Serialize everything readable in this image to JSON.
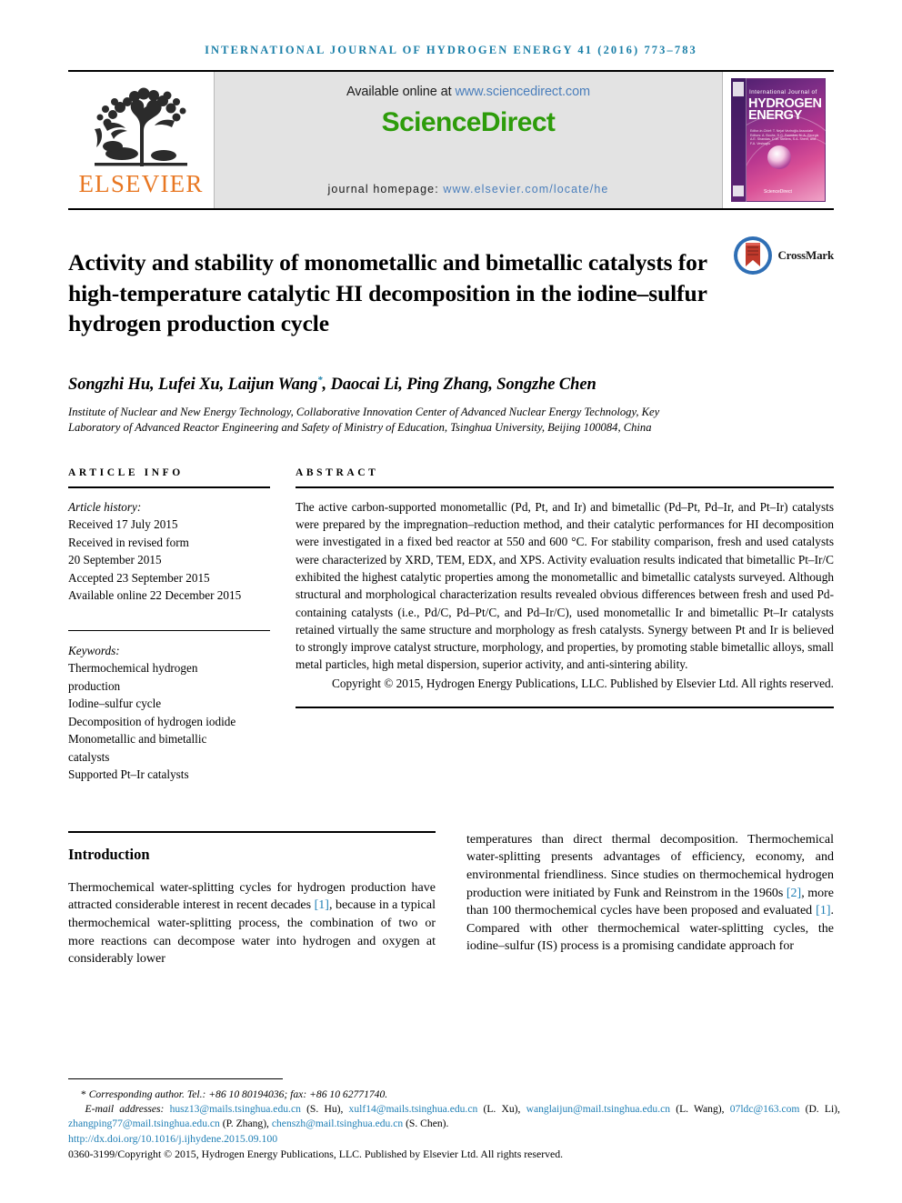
{
  "running_head": "International Journal of Hydrogen Energy 41 (2016) 773–783",
  "masthead": {
    "publisher_name": "ELSEVIER",
    "available_prefix": "Available online at ",
    "available_url": "www.sciencedirect.com",
    "sciencedirect_logo": "ScienceDirect",
    "homepage_prefix": "journal homepage: ",
    "homepage_url": "www.elsevier.com/locate/he",
    "cover": {
      "line_small": "International Journal of",
      "line_big_1": "HYDROGEN",
      "line_big_2": "ENERGY",
      "editors": "Editor-in-Chief:  T. Nejat Veziroğlu\nAssociate Editors:  A. Bouhs, D.G. Foundos, N. A. Georgis\nA.E. Shandas, D.W. Stellers,\nS.A. Sherif, and F.A. Vesiroglu",
      "sd_mark": "ScienceDirect"
    }
  },
  "article": {
    "title": "Activity and stability of monometallic and bimetallic catalysts for high-temperature catalytic HI decomposition in the iodine–sulfur hydrogen production cycle",
    "crossmark_label": "CrossMark",
    "authors": "Songzhi Hu, Lufei Xu, Laijun Wang",
    "authors_corr_marker": "*",
    "authors_rest": ", Daocai Li, Ping Zhang, Songzhe Chen",
    "affiliation": "Institute of Nuclear and New Energy Technology, Collaborative Innovation Center of Advanced Nuclear Energy Technology, Key Laboratory of Advanced Reactor Engineering and Safety of Ministry of Education, Tsinghua University, Beijing 100084, China"
  },
  "article_info": {
    "heading": "ARTICLE INFO",
    "history_label": "Article history:",
    "history": [
      "Received 17 July 2015",
      "Received in revised form",
      "20 September 2015",
      "Accepted 23 September 2015",
      "Available online 22 December 2015"
    ],
    "keywords_label": "Keywords:",
    "keywords": [
      "Thermochemical hydrogen",
      "production",
      "Iodine–sulfur cycle",
      "Decomposition of hydrogen iodide",
      "Monometallic and bimetallic",
      "catalysts",
      "Supported Pt–Ir catalysts"
    ]
  },
  "abstract": {
    "heading": "ABSTRACT",
    "body": "The active carbon-supported monometallic (Pd, Pt, and Ir) and bimetallic (Pd–Pt, Pd–Ir, and Pt–Ir) catalysts were prepared by the impregnation–reduction method, and their catalytic performances for HI decomposition were investigated in a fixed bed reactor at 550 and 600 °C. For stability comparison, fresh and used catalysts were characterized by XRD, TEM, EDX, and XPS. Activity evaluation results indicated that bimetallic Pt–Ir/C exhibited the highest catalytic properties among the monometallic and bimetallic catalysts surveyed. Although structural and morphological characterization results revealed obvious differences between fresh and used Pd-containing catalysts (i.e., Pd/C, Pd–Pt/C, and Pd–Ir/C), used monometallic Ir and bimetallic Pt–Ir catalysts retained virtually the same structure and morphology as fresh catalysts. Synergy between Pt and Ir is believed to strongly improve catalyst structure, morphology, and properties, by promoting stable bimetallic alloys, small metal particles, high metal dispersion, superior activity, and anti-sintering ability.",
    "copyright": "Copyright © 2015, Hydrogen Energy Publications, LLC. Published by Elsevier Ltd. All rights reserved."
  },
  "introduction": {
    "heading": "Introduction",
    "left_parts": {
      "p1a": "Thermochemical water-splitting cycles for hydrogen production have attracted considerable interest in recent decades ",
      "ref1": "[1]",
      "p1b": ", because in a typical thermochemical water-splitting process, the combination of two or more reactions can decompose water into hydrogen and oxygen at considerably lower"
    },
    "right_parts": {
      "p2a": "temperatures than direct thermal decomposition. Thermochemical water-splitting presents advantages of efficiency, economy, and environmental friendliness. Since studies on thermochemical hydrogen production were initiated by Funk and Reinstrom in the 1960s ",
      "ref2": "[2]",
      "p2b": ", more than 100 thermochemical cycles have been proposed and evaluated ",
      "ref3": "[1]",
      "p2c": ". Compared with other thermochemical water-splitting cycles, the iodine–sulfur (IS) process is a promising candidate approach for"
    }
  },
  "footer": {
    "corresponding_marker": "*",
    "corresponding": "Corresponding author. Tel.: +86 10 80194036; fax: +86 10 62771740.",
    "emails_label": "E-mail addresses:",
    "emails": [
      {
        "address": "husz13@mails.tsinghua.edu.cn",
        "person": "(S. Hu),"
      },
      {
        "address": "xulf14@mails.tsinghua.edu.cn",
        "person": "(L. Xu),"
      },
      {
        "address": "wanglaijun@mail.tsinghua.edu.cn",
        "person": "(L. Wang),"
      },
      {
        "address": "07ldc@163.com",
        "person": "(D. Li),"
      },
      {
        "address": "zhangping77@mail.tsinghua.edu.cn",
        "person": "(P. Zhang),"
      },
      {
        "address": "chenszh@mail.tsinghua.edu.cn",
        "person": "(S. Chen)."
      }
    ],
    "doi": "http://dx.doi.org/10.1016/j.ijhydene.2015.09.100",
    "issn_line": "0360-3199/Copyright © 2015, Hydrogen Energy Publications, LLC. Published by Elsevier Ltd. All rights reserved."
  }
}
